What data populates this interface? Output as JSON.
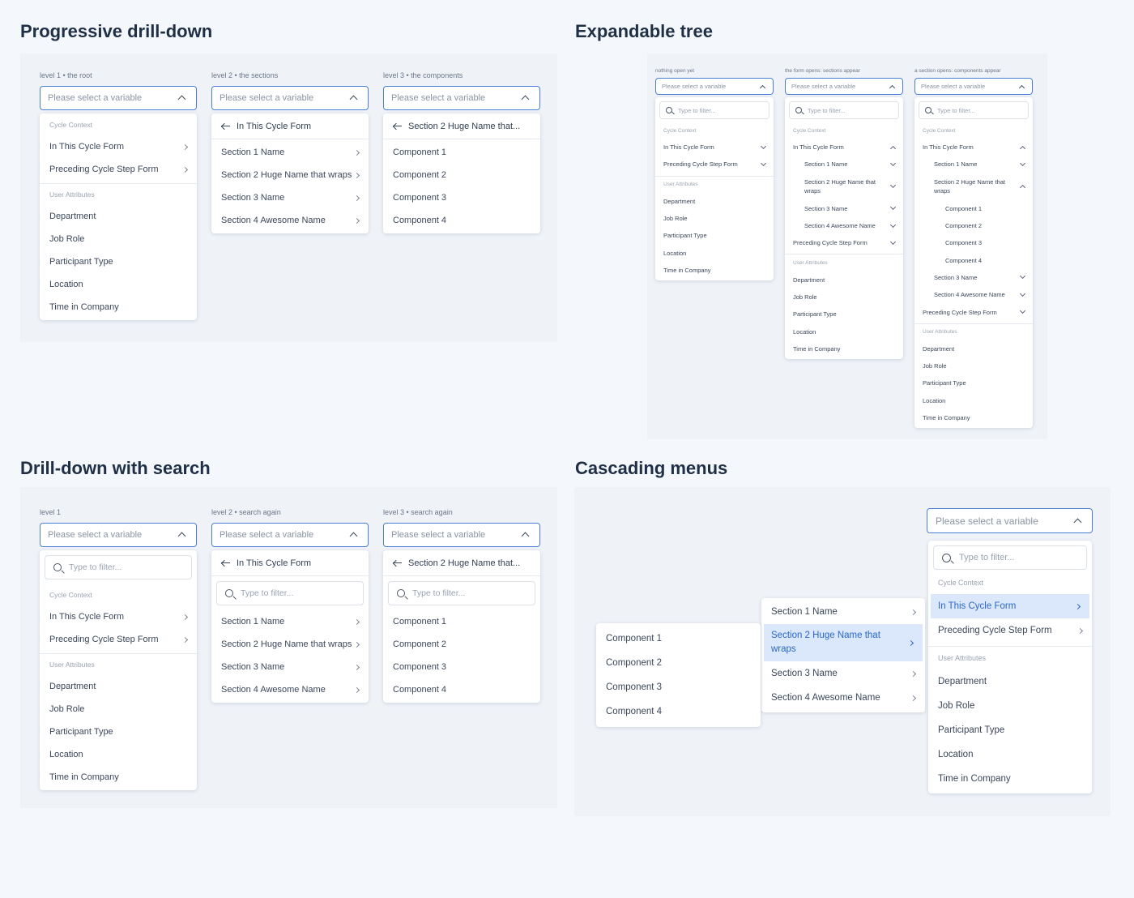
{
  "placeholder": "Please select a variable",
  "search_placeholder": "Type to filter...",
  "groups": {
    "cycle": "Cycle Context",
    "user": "User Attributes"
  },
  "forms": {
    "this": "In This Cycle Form",
    "preceding": "Preceding Cycle Step Form"
  },
  "attributes": [
    "Department",
    "Job Role",
    "Participant Type",
    "Location",
    "Time in Company"
  ],
  "sections": [
    "Section 1 Name",
    "Section 2 Huge Name that wraps",
    "Section 3 Name",
    "Section 4 Awesome Name"
  ],
  "section2_truncated": "Section 2 Huge Name that...",
  "components": [
    "Component 1",
    "Component 2",
    "Component 3",
    "Component 4"
  ],
  "progressive": {
    "title": "Progressive drill-down",
    "captions": [
      "level 1 • the root",
      "level 2 • the sections",
      "level 3 • the components"
    ]
  },
  "tree": {
    "title": "Expandable tree",
    "captions": [
      "nothing open yet",
      "the form opens: sections appear",
      "a section opens: components appear"
    ]
  },
  "search": {
    "title": "Drill-down with search",
    "captions": [
      "level 1",
      "level 2 • search again",
      "level 3 • search again"
    ]
  },
  "cascading": {
    "title": "Cascading menus"
  }
}
